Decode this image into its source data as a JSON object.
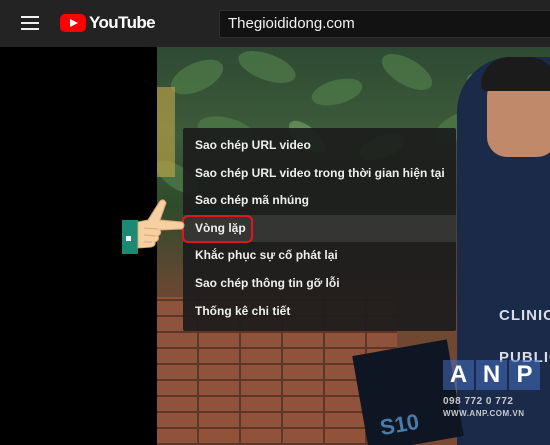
{
  "header": {
    "menu_icon": "hamburger-icon",
    "logo_text": "YouTube",
    "search_value": "Thegioididong.com"
  },
  "context_menu": {
    "items": [
      {
        "label": "Sao chép URL video"
      },
      {
        "label": "Sao chép URL video trong thời gian hiện tại"
      },
      {
        "label": "Sao chép mã nhúng"
      },
      {
        "label": "Vòng lặp",
        "highlighted": true
      },
      {
        "label": "Khắc phục sự cố phát lại"
      },
      {
        "label": "Sao chép thông tin gỡ lỗi"
      },
      {
        "label": "Thống kê chi tiết"
      }
    ]
  },
  "video": {
    "shirt_text": "CLINIC PUBLIC",
    "box_label": "S10"
  },
  "watermark": {
    "letters": [
      "A",
      "N",
      "P"
    ],
    "phone": "098 772 0 772",
    "site": "WWW.ANP.COM.VN"
  },
  "colors": {
    "youtube_red": "#ff0000",
    "highlight_border": "#e0181e",
    "topbar_bg": "#232323"
  },
  "icons": {
    "pointer": "pointing-hand-icon"
  }
}
